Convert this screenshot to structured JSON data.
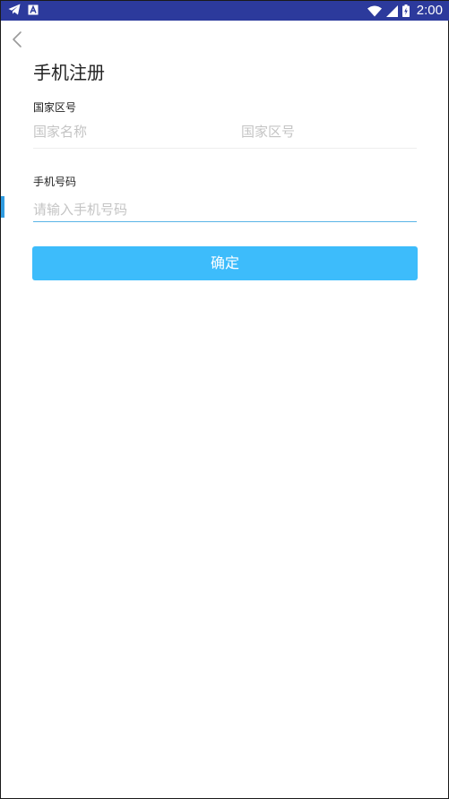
{
  "status_bar": {
    "time": "2:00",
    "background": "#2c3a9c",
    "icons": [
      "telegram-icon",
      "notification-a-icon",
      "wifi-icon",
      "cellular-signal-icon",
      "battery-charging-icon"
    ]
  },
  "header": {
    "back_icon": "chevron-left-icon",
    "title": "手机注册"
  },
  "country": {
    "label": "国家区号",
    "name_placeholder": "国家名称",
    "code_placeholder": "国家区号"
  },
  "phone": {
    "label": "手机号码",
    "placeholder": "请输入手机号码",
    "value": ""
  },
  "confirm_button": {
    "label": "确定",
    "color": "#3dbcfb"
  },
  "colors": {
    "accent": "#3dbcfb",
    "placeholder": "#c4c4c4",
    "input_underline": "#5ab4e6"
  }
}
